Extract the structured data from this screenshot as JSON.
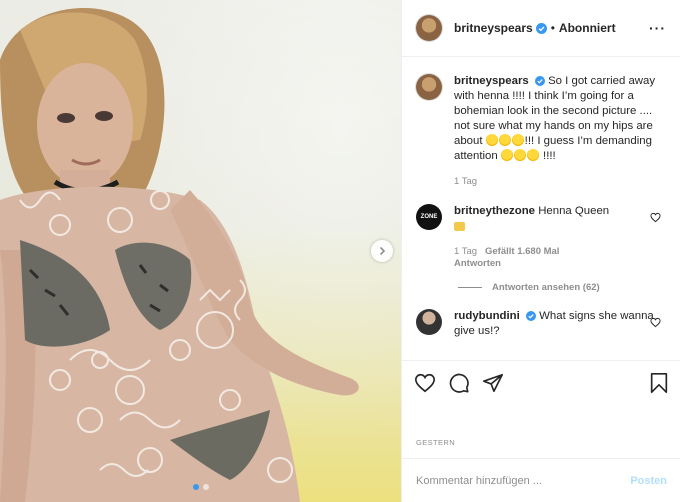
{
  "post": {
    "author": "britneyspears",
    "follow_state": "Abonniert",
    "more_icon": "ellipsis-icon",
    "carousel": {
      "slide_count": 2,
      "current_slide": 1
    }
  },
  "caption": {
    "username": "britneyspears",
    "text_part1": "So I got carried away with henna !!!!  I think I’m going for a bohemian look in the second picture .... not sure what my hands on my hips are about ",
    "text_part2": "!!! I guess I’m demanding attention ",
    "text_part3": " !!!!",
    "age": "1 Tag"
  },
  "comments": [
    {
      "username": "britneythezone",
      "avatar_text": "ZONE",
      "text": "Henna Queen",
      "age": "1 Tag",
      "likes": "Gefällt 1.680 Mal",
      "reply_label": "Antworten",
      "view_replies": "Antworten ansehen (62)"
    },
    {
      "username": "rudybundini",
      "text": "What signs she wanna give us!?"
    }
  ],
  "actions": {
    "icons": [
      "heart-icon",
      "comment-icon",
      "share-icon",
      "bookmark-icon"
    ]
  },
  "date_label": "GESTERN",
  "add_comment": {
    "placeholder": "Kommentar hinzufügen ...",
    "post_label": "Posten"
  },
  "colors": {
    "verified": "#3897f0",
    "muted": "#8e8e8e",
    "post_disabled": "#b2dffc",
    "border": "#efefef"
  }
}
